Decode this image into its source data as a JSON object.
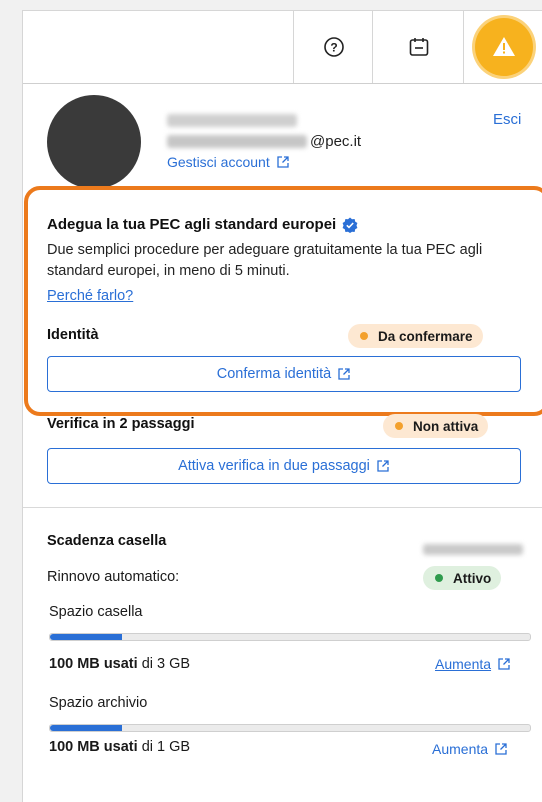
{
  "toolbar": {
    "icons": [
      "help-icon",
      "calendar-icon",
      "warning-icon"
    ],
    "accent_color": "#f7b21e"
  },
  "account": {
    "email_suffix": "@pec.it",
    "manage_label": "Gestisci account",
    "logout_label": "Esci"
  },
  "pec_standard": {
    "title": "Adegua la tua PEC agli standard europei",
    "description": "Due semplici procedure per adeguare gratuitamente la tua PEC agli standard europei, in meno di 5 minuti.",
    "why_link": "Perché farlo?",
    "identity_label": "Identità",
    "identity_status": "Da confermare",
    "confirm_button": "Conferma identità",
    "highlight_color": "#ec7a1c"
  },
  "two_step": {
    "label": "Verifica in 2 passaggi",
    "status": "Non attiva",
    "button": "Attiva verifica in due passaggi"
  },
  "mailbox": {
    "expiry_label": "Scadenza casella",
    "auto_renew_label": "Rinnovo automatico:",
    "auto_renew_status": "Attivo",
    "space_label": "Spazio casella",
    "space_used": "100 MB",
    "space_used_text": "usati",
    "space_total": "di 3 GB",
    "space_fraction": 0.033,
    "space_increase": "Aumenta",
    "archive_label": "Spazio archivio",
    "archive_used": "100 MB usati",
    "archive_total": "di 1 GB",
    "archive_fraction": 0.1,
    "archive_increase": "Aumenta"
  }
}
